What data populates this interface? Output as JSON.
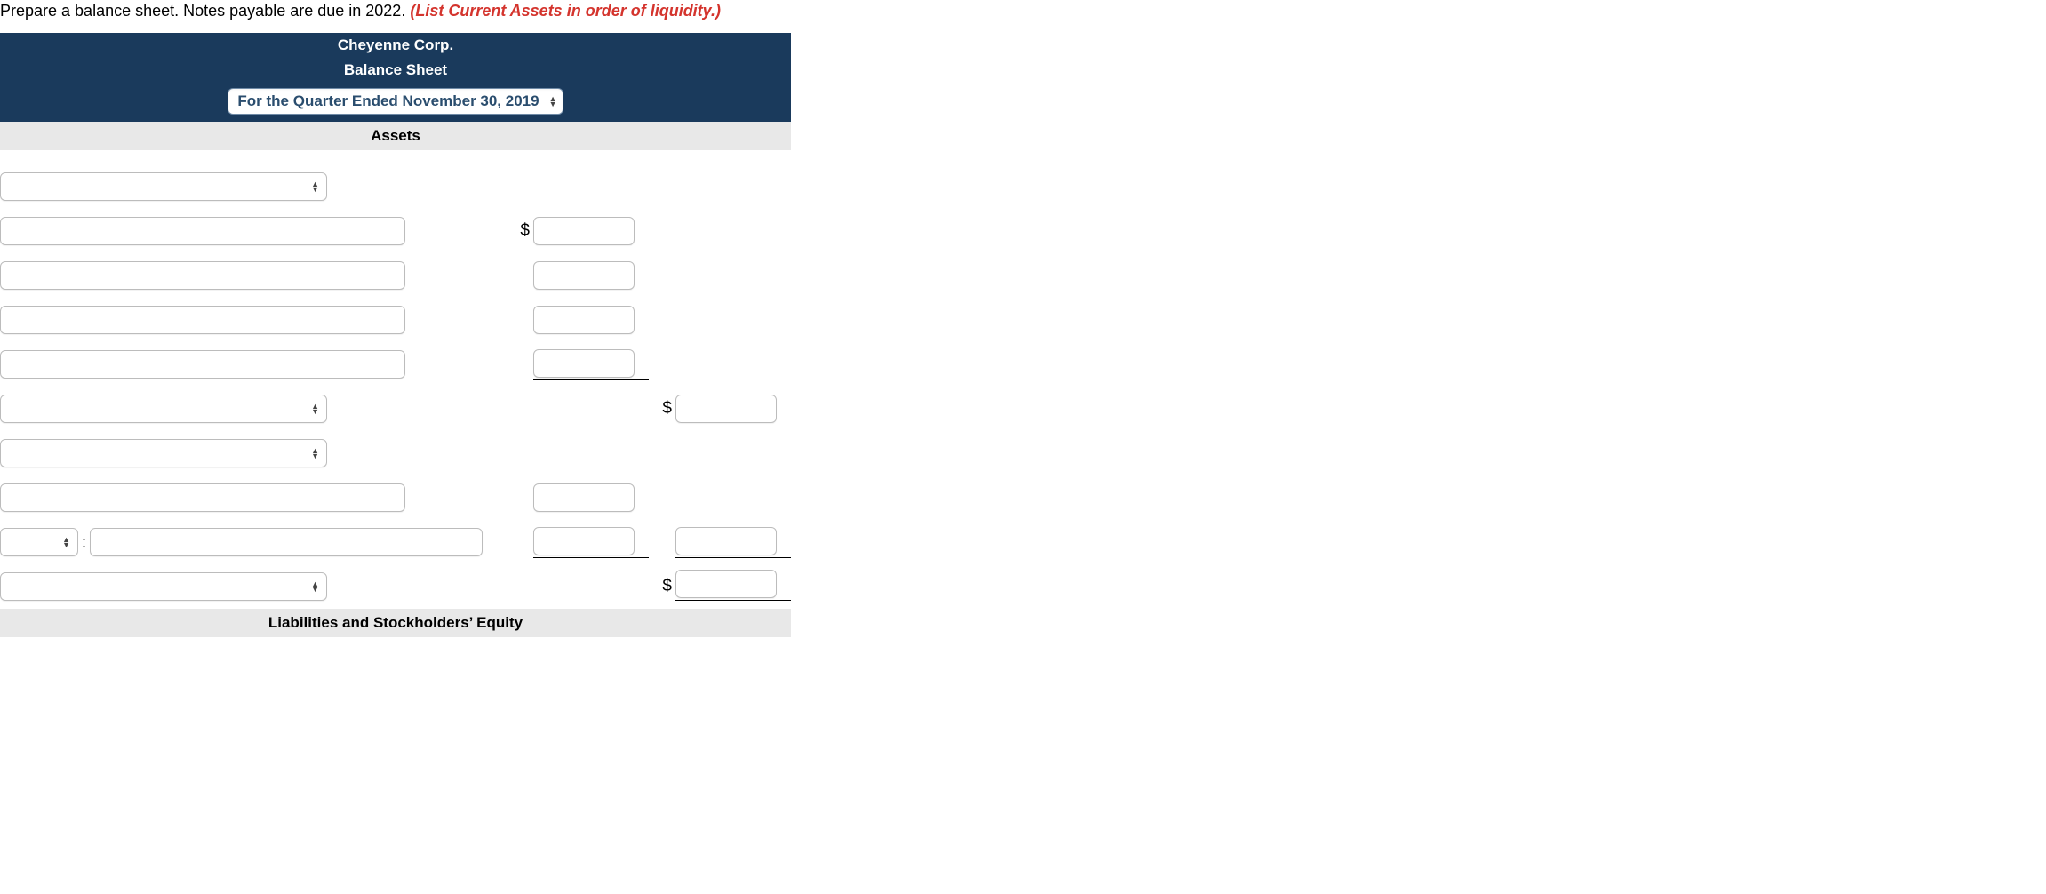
{
  "instruction": {
    "normal": "Prepare a balance sheet. Notes payable are due in 2022. ",
    "emphasis": "(List Current Assets in order of liquidity.)"
  },
  "header": {
    "company": "Cheyenne Corp.",
    "title": "Balance Sheet",
    "period": "For the Quarter Ended November 30, 2019"
  },
  "sections": {
    "assets": "Assets",
    "liabilities": "Liabilities and Stockholders’ Equity"
  },
  "symbols": {
    "dollar": "$",
    "colon": ":"
  }
}
